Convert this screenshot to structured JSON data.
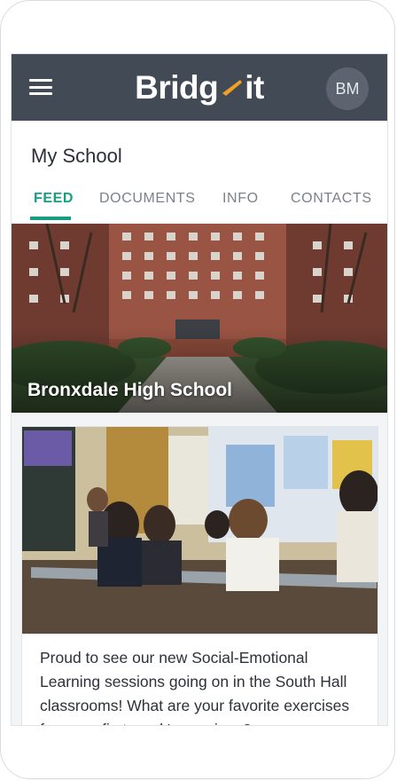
{
  "app": {
    "logo_text_left": "Bridg",
    "logo_text_right": "it",
    "avatar_initials": "BM"
  },
  "colors": {
    "appbar": "#424a56",
    "accent": "#159e82",
    "logo_mark": "#f0a022"
  },
  "header": {
    "title": "My School",
    "tabs": [
      {
        "label": "FEED",
        "active": true
      },
      {
        "label": "DOCUMENTS",
        "active": false
      },
      {
        "label": "INFO",
        "active": false
      },
      {
        "label": "CONTACTS",
        "active": false
      }
    ]
  },
  "hero": {
    "school_name": "Bronxdale High School"
  },
  "post": {
    "text": "Proud to see our new Social-Emotional Learning sessions going on in the South Hall classrooms! What are your favorite exercises from our first week's sessions?"
  },
  "icons": {
    "menu": "hamburger-menu-icon"
  }
}
